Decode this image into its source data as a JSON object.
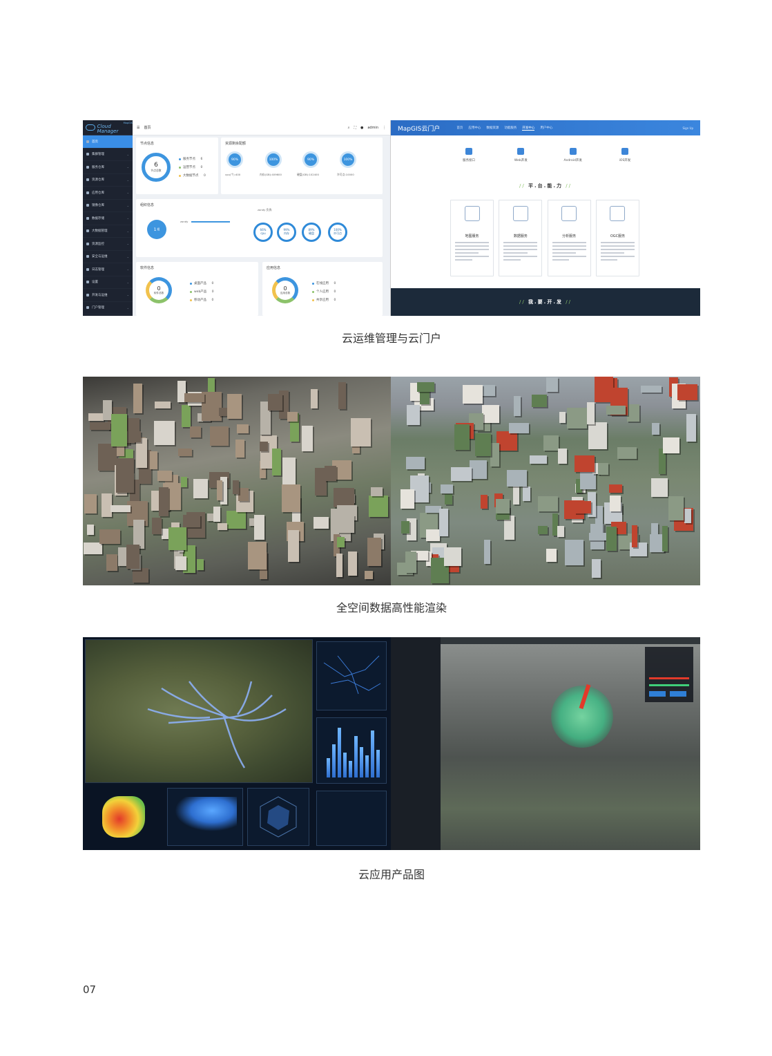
{
  "figure1": {
    "cloud_manager": {
      "logo_text": "Cloud Manager",
      "logo_sub": "MapGIS",
      "sidebar": [
        "首页",
        "集群管理",
        "服务仓库",
        "资源仓库",
        "应用仓库",
        "镜像仓库",
        "数据存储",
        "大数据管理",
        "资源监控",
        "安全与运维",
        "日志管理",
        "设置",
        "开发与运维",
        "门户管理"
      ],
      "topbar": {
        "tab": "首页",
        "user": "admin"
      },
      "node_card": {
        "title": "节点信息",
        "total": "6",
        "total_label": "节点总数",
        "legend": [
          {
            "label": "服务节点",
            "value": "6"
          },
          {
            "label": "运营节点",
            "value": "0"
          },
          {
            "label": "大数据节点",
            "value": "0"
          }
        ]
      },
      "resource_card": {
        "title": "资源剩余配额",
        "gauges": [
          {
            "pct": "90%",
            "label": "cpu(个):400"
          },
          {
            "pct": "100%",
            "label": "内存(GB):409600"
          },
          {
            "pct": "90%",
            "label": "硬盘(GB):102400"
          },
          {
            "pct": "100%",
            "label": "许可点:10000"
          }
        ]
      },
      "cluster_card": {
        "title": "组织信息",
        "count": "1",
        "unit": "组",
        "user": "zondy",
        "owner": "zondy 负责:",
        "rings": [
          {
            "pct": "66%",
            "label": "cpu"
          },
          {
            "pct": "99%",
            "label": "内存"
          },
          {
            "pct": "89%",
            "label": "硬盘"
          },
          {
            "pct": "100%",
            "label": "许可点"
          }
        ]
      },
      "software_card": {
        "title": "软件信息",
        "total": "0",
        "total_label": "软件总数",
        "legend": [
          {
            "label": "桌面产品",
            "value": "0"
          },
          {
            "label": "web产品",
            "value": "0"
          },
          {
            "label": "移动产品",
            "value": "0"
          }
        ]
      },
      "app_card": {
        "title": "应用信息",
        "total": "0",
        "total_label": "应用总数",
        "legend": [
          {
            "label": "在线应用",
            "value": "0"
          },
          {
            "label": "个人应用",
            "value": "0"
          },
          {
            "label": "共享应用",
            "value": "0"
          }
        ]
      }
    },
    "portal": {
      "brand": "MapGIS云门户",
      "nav": [
        "首页",
        "应用中心",
        "数据资源",
        "功能服务",
        "开发中心",
        "用户中心"
      ],
      "nav_current": 4,
      "login": "Sign Up",
      "sdk": [
        "服务接口",
        "Web开发",
        "Android开发",
        "iOS开发"
      ],
      "section_title": "平.台.能.力",
      "cards": [
        "地图服务",
        "数据服务",
        "分析服务",
        "OGC服务"
      ],
      "footer_title": "我.要.开.发"
    }
  },
  "captions": [
    "云运维管理与云门户",
    "全空间数据高性能渲染",
    "云应用产品图"
  ],
  "page_number": "07",
  "colors": {
    "accent_blue": "#3a8ee6",
    "sidebar_dark": "#1d2330",
    "portal_blue": "#2b6cc4",
    "portal_footer": "#1c2a3a"
  }
}
